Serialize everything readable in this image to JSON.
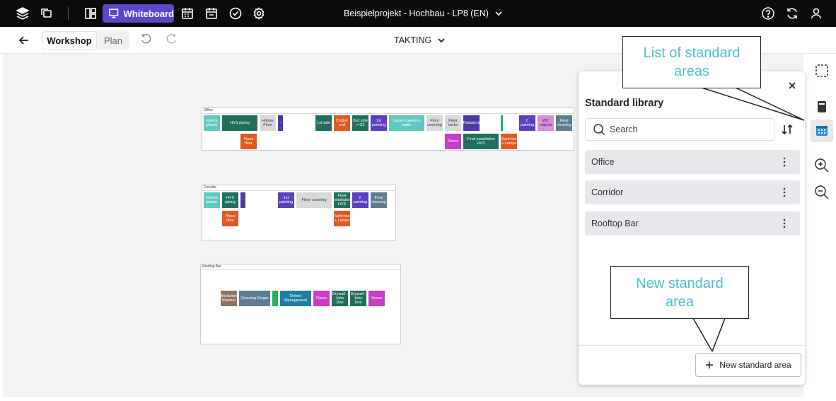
{
  "topbar": {
    "whiteboard_label": "Whiteboard",
    "project_title": "Beispielprojekt - Hochbau - LP8 (EN)"
  },
  "subbar": {
    "tab_workshop": "Workshop",
    "tab_plan": "Plan",
    "takting": "TAKTING"
  },
  "zones": {
    "office": {
      "title": "Office",
      "blocks": [
        {
          "label": "Interior plaster",
          "color": "#5fc9c0"
        },
        {
          "label": "HVS piping",
          "color": "#1f6e5e"
        },
        {
          "label": "Hollow Floor",
          "color": "#d9d9d9"
        },
        {
          "label": "-",
          "color": "#4a3aa8"
        },
        {
          "label": "1st side",
          "color": "#1f6e5e"
        },
        {
          "label": "Cables wall",
          "color": "#e25a22"
        },
        {
          "label": "2nd side + Q2",
          "color": "#1f6e5e"
        },
        {
          "label": "1st painting",
          "color": "#5a3fbf"
        },
        {
          "label": "System partition walls",
          "color": "#5fc9c0"
        },
        {
          "label": "Floor covering",
          "color": "#d9d9d9"
        },
        {
          "label": "Floor tanks",
          "color": "#d9d9d9"
        },
        {
          "label": "Radiators",
          "color": "#4a3aa8"
        },
        {
          "label": "",
          "color": "#21b259"
        },
        {
          "label": "2. painting",
          "color": "#5a3fbf"
        },
        {
          "label": "WC objects",
          "color": "#d58ee0"
        },
        {
          "label": "Final cleaning",
          "color": "#5d7d92"
        },
        {
          "label": "Pipes floor",
          "color": "#e25a22"
        },
        {
          "label": "Doors",
          "color": "#c93ec9"
        },
        {
          "label": "Final installation HVS",
          "color": "#1f6e5e"
        },
        {
          "label": "Switches + Lamps",
          "color": "#e25a22"
        }
      ]
    },
    "corridor": {
      "title": "Corridor",
      "blocks": [
        {
          "label": "Interior plaster",
          "color": "#5fc9c0"
        },
        {
          "label": "HVS piping",
          "color": "#1f6e5e"
        },
        {
          "label": "-",
          "color": "#4a3aa8"
        },
        {
          "label": "1st painting",
          "color": "#5a3fbf"
        },
        {
          "label": "Floor covering",
          "color": "#d9d9d9"
        },
        {
          "label": "Final installation HVS",
          "color": "#1f6e5e"
        },
        {
          "label": "2. painting",
          "color": "#5a3fbf"
        },
        {
          "label": "Final cleaning",
          "color": "#5d7d92"
        },
        {
          "label": "Pipes floor",
          "color": "#e25a22"
        },
        {
          "label": "Switches + Lamps",
          "color": "#e25a22"
        }
      ]
    },
    "rooftop": {
      "title": "Rooftop Bar",
      "blocks": [
        {
          "label": "Brickwork Nuemer",
          "color": "#8b7560"
        },
        {
          "label": "Cleaning Rieger",
          "color": "#5d7d92"
        },
        {
          "label": "-",
          "color": "#21b259"
        },
        {
          "label": "Defect Management",
          "color": "#1f7fa0"
        },
        {
          "label": "Doors",
          "color": "#c93ec9"
        },
        {
          "label": "Drywall - John Doe",
          "color": "#1f6e5e"
        },
        {
          "label": "Drywall - John Doe",
          "color": "#1f6e5e"
        },
        {
          "label": "Doors",
          "color": "#c93ec9"
        }
      ]
    }
  },
  "panel": {
    "title": "Standard library",
    "search_placeholder": "Search",
    "items": [
      "Office",
      "Corridor",
      "Rooftop Bar"
    ],
    "new_button": "New standard area"
  },
  "callouts": {
    "list": "List of standard areas",
    "new": "New standard area"
  }
}
